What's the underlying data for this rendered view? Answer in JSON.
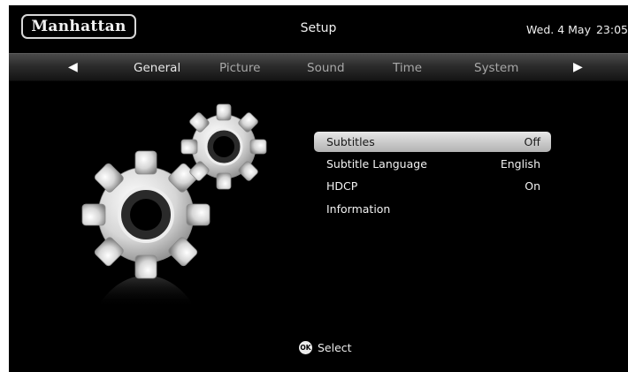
{
  "header": {
    "logo_text": "Manhattan",
    "title": "Setup",
    "date": "Wed. 4 May",
    "time": "23:05"
  },
  "tabs": [
    {
      "label": "General",
      "active": true
    },
    {
      "label": "Picture",
      "active": false
    },
    {
      "label": "Sound",
      "active": false
    },
    {
      "label": "Time",
      "active": false
    },
    {
      "label": "System",
      "active": false
    }
  ],
  "nav": {
    "left_icon": "arrow-left-icon",
    "right_icon": "arrow-right-icon"
  },
  "menu": [
    {
      "label": "Subtitles",
      "value": "Off",
      "selected": true
    },
    {
      "label": "Subtitle Language",
      "value": "English",
      "selected": false
    },
    {
      "label": "HDCP",
      "value": "On",
      "selected": false
    },
    {
      "label": "Information",
      "value": "",
      "selected": false
    }
  ],
  "footer": {
    "button_glyph": "OK",
    "hint_label": "Select"
  },
  "colors": {
    "background": "#000000",
    "highlight": "#c9c9c9",
    "text": "#f2f2f2"
  }
}
